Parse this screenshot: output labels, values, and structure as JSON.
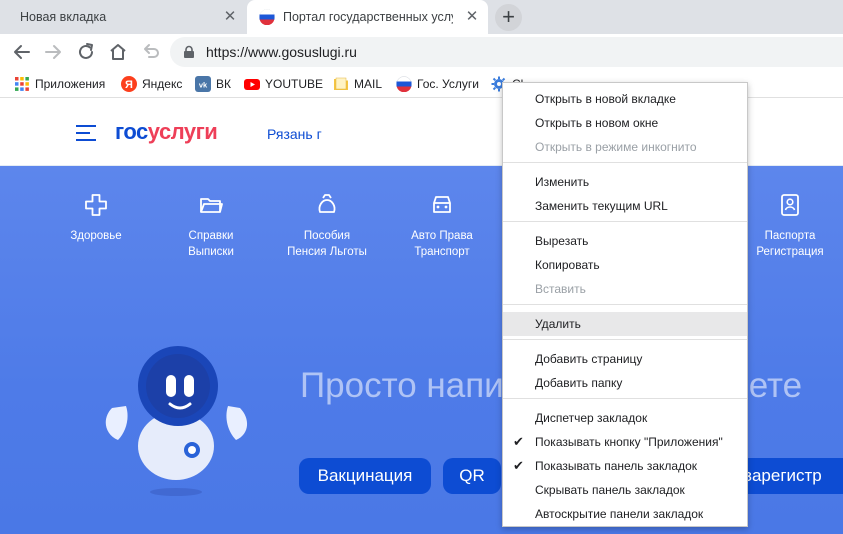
{
  "browser": {
    "tabs": [
      {
        "title": "Новая вкладка",
        "active": false
      },
      {
        "title": "Портал государственных услуг Р",
        "active": true
      }
    ],
    "new_tab_label": "+",
    "close_glyph": "✕",
    "url": "https://www.gosuslugi.ru",
    "bookmarks": [
      {
        "label": "Приложения",
        "icon": "apps-grid-icon"
      },
      {
        "label": "Яндекс",
        "icon": "yandex-icon"
      },
      {
        "label": "ВК",
        "icon": "vk-icon"
      },
      {
        "label": "YOUTUBE",
        "icon": "youtube-icon"
      },
      {
        "label": "MAIL",
        "icon": "folder-icon"
      },
      {
        "label": "Гос. Услуги",
        "icon": "russia-flag-icon"
      },
      {
        "label": "Сl",
        "icon": "settings-gear-icon"
      }
    ]
  },
  "site": {
    "logo_part1": "гос",
    "logo_part2": "услуги",
    "region": "Рязань г",
    "categories": [
      {
        "line1": "Здоровье",
        "line2": "",
        "icon": "health-cross-icon"
      },
      {
        "line1": "Справки",
        "line2": "Выписки",
        "icon": "folder-icon"
      },
      {
        "line1": "Пособия",
        "line2": "Пенсия Льготы",
        "icon": "wallet-icon"
      },
      {
        "line1": "Авто Права",
        "line2": "Транспорт",
        "icon": "car-icon"
      },
      {
        "line1": "Паспорта",
        "line2": "Регистрация",
        "icon": "passport-icon"
      }
    ],
    "hero_text_left": "Просто напи",
    "hero_text_right": "ете",
    "quick_buttons": [
      "Вакцинация",
      "QR",
      "к зарегистр"
    ]
  },
  "context_menu": {
    "items": [
      {
        "label": "Открыть в новой вкладке",
        "disabled": false,
        "checked": false
      },
      {
        "label": "Открыть в новом окне",
        "disabled": false,
        "checked": false
      },
      {
        "label": "Открыть в режиме инкогнито",
        "disabled": true,
        "checked": false
      },
      {
        "label": "Изменить",
        "disabled": false,
        "checked": false
      },
      {
        "label": "Заменить текущим URL",
        "disabled": false,
        "checked": false
      },
      {
        "label": "Вырезать",
        "disabled": false,
        "checked": false
      },
      {
        "label": "Копировать",
        "disabled": false,
        "checked": false
      },
      {
        "label": "Вставить",
        "disabled": true,
        "checked": false
      },
      {
        "label": "Удалить",
        "disabled": false,
        "checked": false,
        "hovered": true
      },
      {
        "label": "Добавить страницу",
        "disabled": false,
        "checked": false
      },
      {
        "label": "Добавить папку",
        "disabled": false,
        "checked": false
      },
      {
        "label": "Диспетчер закладок",
        "disabled": false,
        "checked": false
      },
      {
        "label": "Показывать кнопку \"Приложения\"",
        "disabled": false,
        "checked": true
      },
      {
        "label": "Показывать панель закладок",
        "disabled": false,
        "checked": true
      },
      {
        "label": "Скрывать панель закладок",
        "disabled": false,
        "checked": false
      },
      {
        "label": "Автоскрытие панели закладок",
        "disabled": false,
        "checked": false
      }
    ],
    "check_glyph": "✔"
  },
  "colors": {
    "brand_blue": "#0d4cd3",
    "brand_red": "#ee3f58",
    "hero_blue": "#5581ea"
  }
}
